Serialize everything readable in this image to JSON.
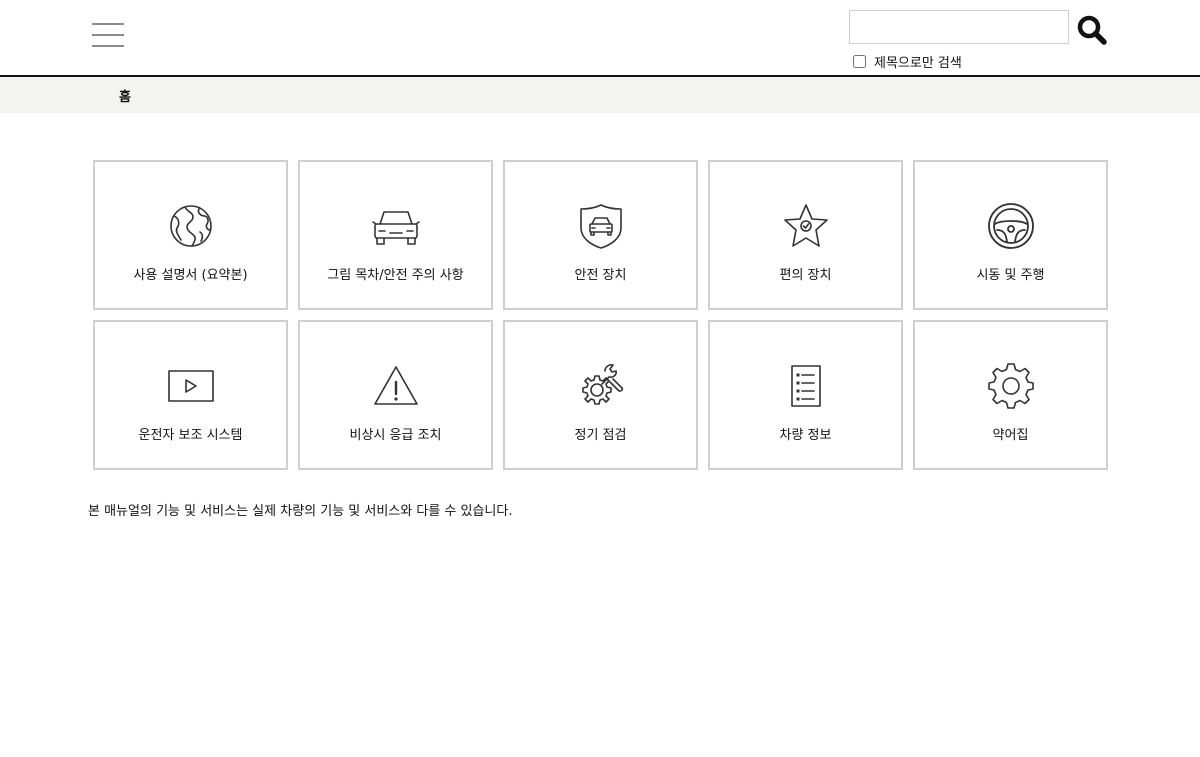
{
  "header": {
    "search": {
      "value": "",
      "placeholder": ""
    },
    "title_only_label": "제목으로만 검색"
  },
  "breadcrumb": {
    "home": "홈"
  },
  "tiles": [
    {
      "label": "사용 설명서 (요약본)",
      "icon": "globe-icon"
    },
    {
      "label": "그림 목차/안전 주의 사항",
      "icon": "car-icon"
    },
    {
      "label": "안전 장치",
      "icon": "shield-car-icon"
    },
    {
      "label": "편의 장치",
      "icon": "star-check-icon"
    },
    {
      "label": "시동 및 주행",
      "icon": "steering-wheel-icon"
    },
    {
      "label": "운전자 보조 시스템",
      "icon": "video-play-icon"
    },
    {
      "label": "비상시 응급 조치",
      "icon": "warning-triangle-icon"
    },
    {
      "label": "정기 점검",
      "icon": "gear-wrench-icon"
    },
    {
      "label": "차량 정보",
      "icon": "checklist-icon"
    },
    {
      "label": "약어집",
      "icon": "gear-icon"
    }
  ],
  "disclaimer": "본 매뉴얼의 기능 및 서비스는 실제 차량의 기능 및 서비스와 다를 수 있습니다.",
  "colors": {
    "header_border": "#111111",
    "breadcrumb_bg": "#f3f3f1",
    "tile_border": "#cfcfcf",
    "icon_stroke": "#333333"
  }
}
